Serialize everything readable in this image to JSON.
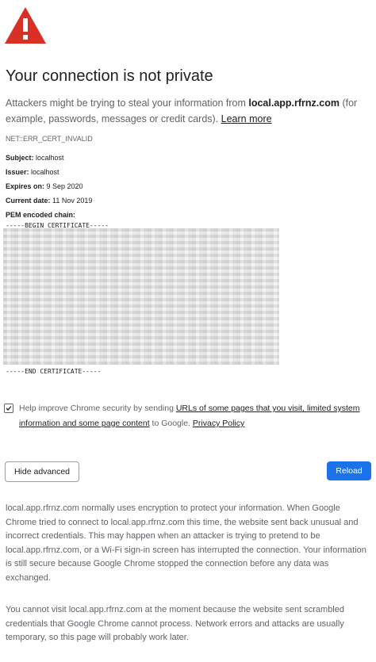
{
  "icon": {
    "name": "warning-triangle-icon",
    "color": "#d93025"
  },
  "heading": "Your connection is not private",
  "intro": {
    "text_before": "Attackers might be trying to steal your information from ",
    "domain": "local.app.rfrnz.com",
    "text_after": " (for example, passwords, messages or credit cards). ",
    "learn_more": "Learn more"
  },
  "error_code": "NET::ERR_CERT_INVALID",
  "certificate": {
    "subject_label": "Subject:",
    "subject_value": " localhost",
    "issuer_label": "Issuer:",
    "issuer_value": " localhost",
    "expires_label": "Expires on:",
    "expires_value": " 9 Sep 2020",
    "current_label": "Current date:",
    "current_value": " 11 Nov 2019",
    "pem_label": "PEM encoded chain:",
    "begin": "-----BEGIN CERTIFICATE-----",
    "end": "-----END CERTIFICATE-----"
  },
  "opt_in": {
    "checked": true,
    "text_before": "Help improve Chrome security by sending ",
    "link1": "URLs of some pages that you visit, limited system information and some page content",
    "text_middle": " to Google. ",
    "link2": "Privacy Policy"
  },
  "buttons": {
    "hide_advanced": "Hide advanced",
    "reload": "Reload"
  },
  "details": [
    "local.app.rfrnz.com normally uses encryption to protect your information. When Google Chrome tried to connect to local.app.rfrnz.com this time, the website sent back unusual and incorrect credentials. This may happen when an attacker is trying to pretend to be local.app.rfrnz.com, or a Wi-Fi sign-in screen has interrupted the connection. Your information is still secure because Google Chrome stopped the connection before any data was exchanged.",
    "You cannot visit local.app.rfrnz.com at the moment because the website sent scrambled credentials that Google Chrome cannot process. Network errors and attacks are usually temporary, so this page will probably work later."
  ],
  "colors": {
    "primary": "#1a73e8",
    "danger": "#d93025",
    "text": "#202124",
    "secondary_text": "#5f6368"
  }
}
